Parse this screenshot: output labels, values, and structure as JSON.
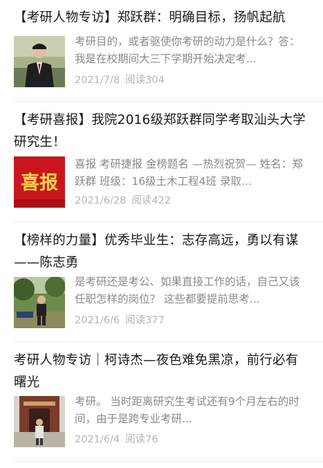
{
  "articles": [
    {
      "title": "【考研人物专访】郑跃群：明确目标，扬帆起航",
      "snippet": "考研目的，或者驱使你考研的动力是什么？答：我是在校期间大三下学期开始决定考...",
      "date": "2021/7/8",
      "reads": "阅读304",
      "thumb_icon": "portrait-photo"
    },
    {
      "title": "【考研喜报】我院2016级郑跃群同学考取汕头大学研究生！",
      "snippet": "喜报 考研捷报 金榜题名 —热烈祝贺— 姓名：郑跃群 班级：16级土木工程4班 录取...",
      "date": "2021/6/28",
      "reads": "阅读422",
      "thumb_text": "喜报",
      "thumb_colors": {
        "background": "#c9161c",
        "text": "#f7d54a"
      }
    },
    {
      "title": "【榜样的力量】优秀毕业生：志存高远，勇以有谋——陈志勇",
      "snippet": "是考研还是考公、如果直接工作的话，自己又该任职怎样的岗位？ 这些都要提前思考...",
      "date": "2021/6/6",
      "reads": "阅读377",
      "thumb_icon": "outdoor-photo"
    },
    {
      "title": "考研人物专访｜柯诗杰—夜色难免黑凉，前行必有曙光",
      "snippet": "考研。 当时距离研究生考试还有9个月左右的时间，由于是跨专业考研...",
      "date": "2021/6/4",
      "reads": "阅读76",
      "thumb_icon": "campus-gate-photo"
    }
  ]
}
